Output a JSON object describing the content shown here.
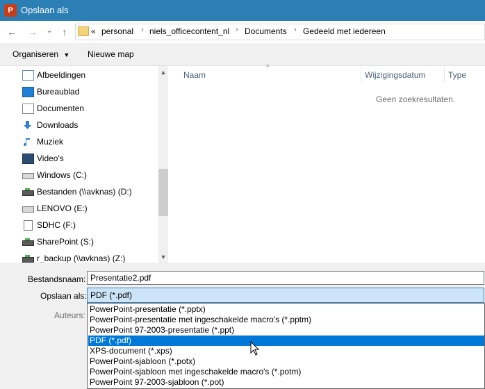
{
  "window": {
    "title": "Opslaan als",
    "app_icon_text": "P"
  },
  "nav": {
    "back": "←",
    "forward": "→",
    "dropdown": "⌄",
    "up": "↑",
    "breadcrumbs": [
      "«",
      "personal",
      "niels_officecontent_nl",
      "Documents",
      "Gedeeld met iedereen"
    ],
    "separator": "›"
  },
  "toolbar": {
    "organize": "Organiseren",
    "new_folder": "Nieuwe map"
  },
  "sidebar": {
    "items": [
      {
        "label": "Afbeeldingen",
        "icon": "pictures-icon"
      },
      {
        "label": "Bureaublad",
        "icon": "desktop-icon"
      },
      {
        "label": "Documenten",
        "icon": "documents-icon"
      },
      {
        "label": "Downloads",
        "icon": "downloads-icon"
      },
      {
        "label": "Muziek",
        "icon": "music-icon"
      },
      {
        "label": "Video's",
        "icon": "videos-icon"
      },
      {
        "label": "Windows (C:)",
        "icon": "drive-icon"
      },
      {
        "label": "Bestanden (\\\\avknas) (D:)",
        "icon": "network-drive-icon"
      },
      {
        "label": "LENOVO (E:)",
        "icon": "drive-icon"
      },
      {
        "label": "SDHC (F:)",
        "icon": "sd-card-icon"
      },
      {
        "label": "SharePoint (S:)",
        "icon": "network-drive-icon"
      },
      {
        "label": "r_backup (\\\\avknas) (Z:)",
        "icon": "network-drive-icon"
      }
    ]
  },
  "content": {
    "columns": [
      "Naam",
      "Wijzigingsdatum",
      "Type"
    ],
    "sort_indicator": "^",
    "empty_message": "Geen zoekresultaten."
  },
  "form": {
    "filename_label": "Bestandsnaam:",
    "filename_value": "Presentatie2.pdf",
    "saveas_label": "Opslaan als:",
    "saveas_value": "PDF (*.pdf)",
    "authors_label": "Auteurs:",
    "options": [
      "PowerPoint-presentatie (*.pptx)",
      "PowerPoint-presentatie met ingeschakelde macro's (*.pptm)",
      "PowerPoint 97-2003-presentatie (*.ppt)",
      "PDF (*.pdf)",
      "XPS-document (*.xps)",
      "PowerPoint-sjabloon (*.potx)",
      "PowerPoint-sjabloon met ingeschakelde macro's (*.potm)",
      "PowerPoint 97-2003-sjabloon (*.pot)"
    ],
    "selected_index": 3
  }
}
